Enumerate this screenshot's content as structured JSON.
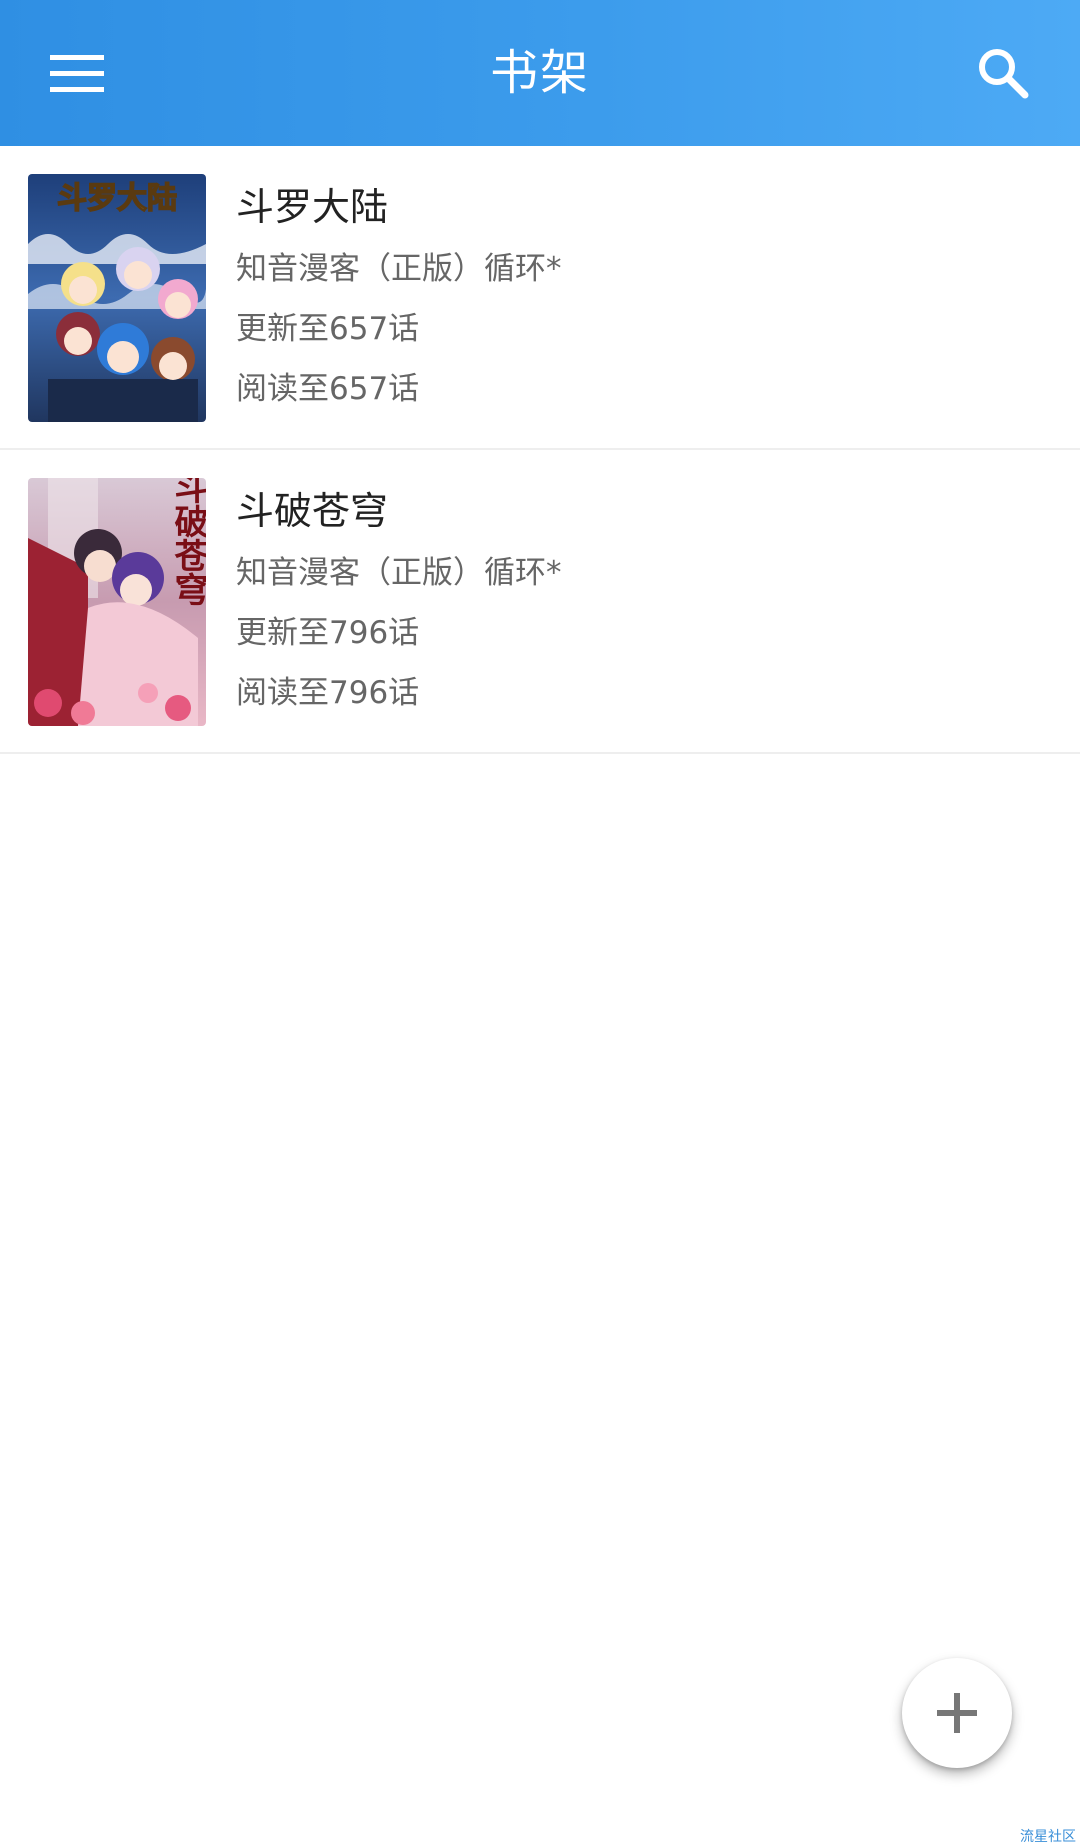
{
  "app_bar": {
    "title": "书架",
    "menu_icon": "menu-icon",
    "search_icon": "search-icon",
    "color_start": "#2f8fe3",
    "color_end": "#4daaf5"
  },
  "books": [
    {
      "title": "斗罗大陆",
      "source": "知音漫客（正版）循环*",
      "updated": "更新至657话",
      "read": "阅读至657话",
      "cover_text": "斗罗大陆"
    },
    {
      "title": "斗破苍穹",
      "source": "知音漫客（正版）循环*",
      "updated": "更新至796话",
      "read": "阅读至796话",
      "cover_text": "斗破苍穹"
    }
  ],
  "fab": {
    "icon": "plus-icon"
  },
  "watermark": "流星社区"
}
